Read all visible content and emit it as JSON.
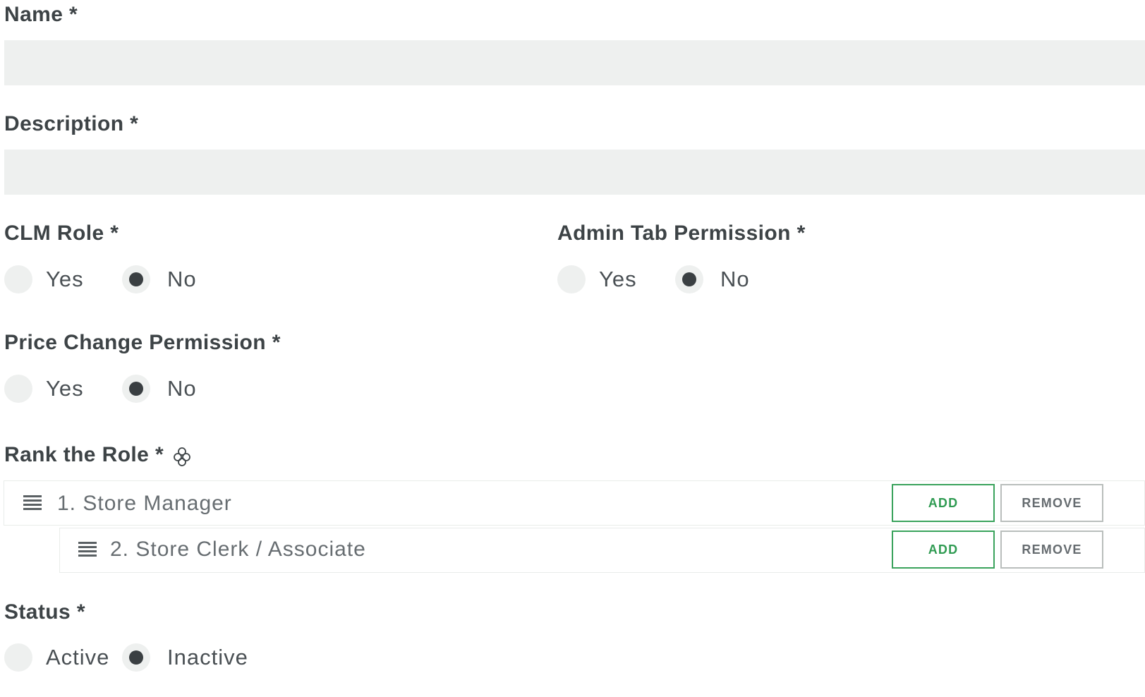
{
  "form": {
    "name": {
      "label": "Name *",
      "value": "",
      "placeholder": ""
    },
    "description": {
      "label": "Description *",
      "value": "",
      "placeholder": ""
    },
    "clm_role": {
      "label": "CLM Role *",
      "options": [
        "Yes",
        "No"
      ],
      "selected": "No"
    },
    "admin_tab_permission": {
      "label": "Admin Tab Permission *",
      "options": [
        "Yes",
        "No"
      ],
      "selected": "No"
    },
    "price_change_permission": {
      "label": "Price Change Permission *",
      "options": [
        "Yes",
        "No"
      ],
      "selected": "No"
    },
    "rank": {
      "label": "Rank the Role *",
      "move_icon": "move-arrows-icon",
      "items": [
        {
          "label": "1. Store Manager",
          "add_label": "ADD",
          "remove_label": "REMOVE"
        },
        {
          "label": "2. Store Clerk / Associate",
          "add_label": "ADD",
          "remove_label": "REMOVE"
        }
      ]
    },
    "status": {
      "label": "Status *",
      "options": [
        "Active",
        "Inactive"
      ],
      "selected": "Inactive"
    }
  },
  "colors": {
    "input_bg": "#eef0ef",
    "add_accent": "#2f9b52",
    "remove_border": "#b9bebc",
    "text_dark": "#3d4346"
  }
}
